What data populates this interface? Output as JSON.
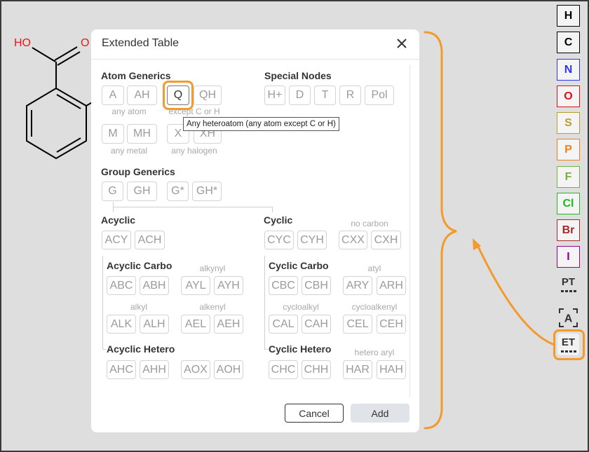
{
  "colors": {
    "annotation": "#f29a2e",
    "heteroatom_label": "#e01a1a"
  },
  "canvas": {
    "atom_labels": {
      "hydroxyl": "HO",
      "carbonyl_oxygen": "O"
    }
  },
  "dialog": {
    "title": "Extended Table",
    "close_icon": "close-icon",
    "atom_generics": {
      "heading": "Atom Generics",
      "buttons": [
        {
          "label": "A"
        },
        {
          "label": "AH"
        },
        {
          "label": "Q",
          "selected": true
        },
        {
          "label": "QH"
        },
        {
          "label": "M"
        },
        {
          "label": "MH"
        },
        {
          "label": "X"
        },
        {
          "label": "XH"
        }
      ],
      "captions": [
        "any atom",
        "except C or H",
        "any metal",
        "any halogen"
      ]
    },
    "tooltip": "Any heteroatom (any atom except C or H)",
    "special_nodes": {
      "heading": "Special Nodes",
      "buttons": [
        "H+",
        "D",
        "T",
        "R",
        "Pol"
      ]
    },
    "group_generics": {
      "heading": "Group Generics",
      "buttons": [
        "G",
        "GH",
        "G*",
        "GH*"
      ]
    },
    "acyclic": {
      "heading": "Acyclic",
      "buttons": [
        "ACY",
        "ACH"
      ],
      "carbo": {
        "heading": "Acyclic Carbo",
        "captions": [
          "alkynyl",
          "alkyl",
          "alkenyl"
        ],
        "buttons": [
          "ABC",
          "ABH",
          "AYL",
          "AYH",
          "ALK",
          "ALH",
          "AEL",
          "AEH"
        ]
      },
      "hetero": {
        "heading": "Acyclic Hetero",
        "buttons": [
          "AHC",
          "AHH",
          "AOX",
          "AOH"
        ]
      }
    },
    "cyclic": {
      "heading": "Cyclic",
      "caption": "no carbon",
      "buttons": [
        "CYC",
        "CYH",
        "CXX",
        "CXH"
      ],
      "carbo": {
        "heading": "Cyclic Carbo",
        "captions": [
          "atyl",
          "cycloalkyl",
          "cycloalkenyl"
        ],
        "buttons": [
          "CBC",
          "CBH",
          "ARY",
          "ARH",
          "CAL",
          "CAH",
          "CEL",
          "CEH"
        ]
      },
      "hetero": {
        "heading": "Cyclic Hetero",
        "caption": "hetero aryl",
        "buttons": [
          "CHC",
          "CHH",
          "HAR",
          "HAH"
        ]
      }
    },
    "footer": {
      "cancel": "Cancel",
      "add": "Add"
    }
  },
  "toolbar": {
    "elements": [
      {
        "symbol": "H",
        "color": "#000000"
      },
      {
        "symbol": "C",
        "color": "#000000"
      },
      {
        "symbol": "N",
        "color": "#3232f0"
      },
      {
        "symbol": "O",
        "color": "#e01010"
      },
      {
        "symbol": "S",
        "color": "#b4a02a"
      },
      {
        "symbol": "P",
        "color": "#f08010"
      },
      {
        "symbol": "F",
        "color": "#76b043"
      },
      {
        "symbol": "Cl",
        "color": "#22b822"
      },
      {
        "symbol": "Br",
        "color": "#a52a2a"
      },
      {
        "symbol": "I",
        "color": "#940094"
      }
    ],
    "tools": [
      {
        "label": "PT",
        "icon": "periodic-table-icon"
      },
      {
        "label": "A",
        "icon": "any-atom-icon"
      },
      {
        "label": "ET",
        "icon": "extended-table-icon",
        "active": true
      }
    ]
  }
}
